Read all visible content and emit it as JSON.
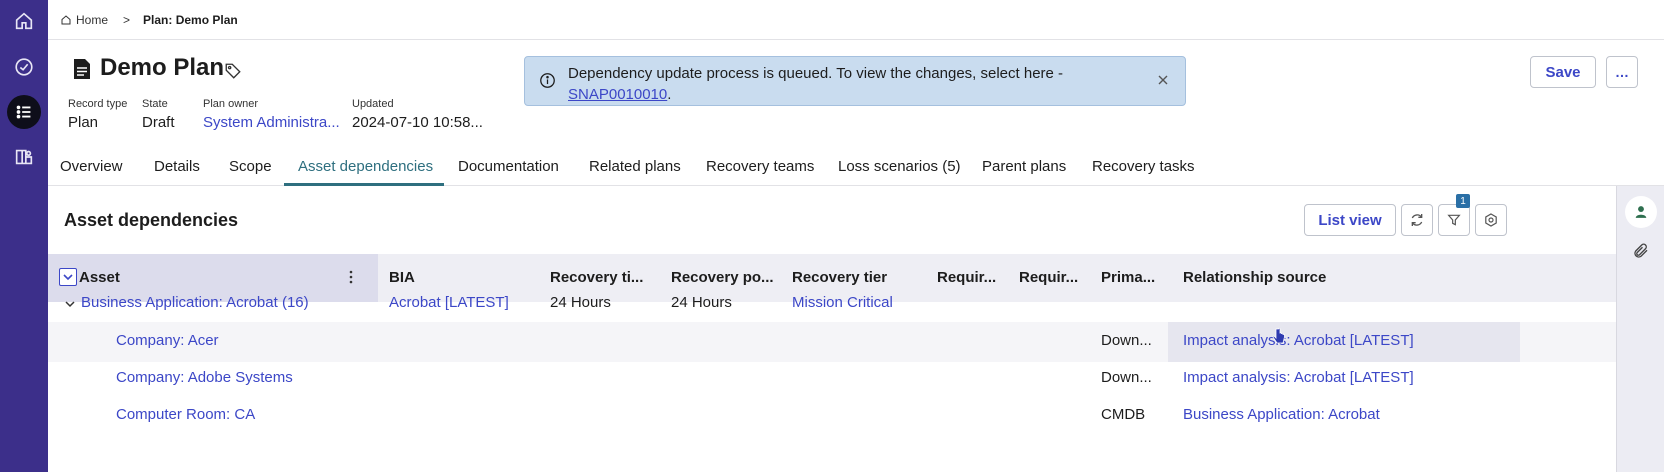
{
  "breadcrumb": {
    "home": "Home",
    "separator": ">",
    "current": "Plan: Demo Plan"
  },
  "record": {
    "title": "Demo Plan",
    "fields": [
      {
        "label": "Record type",
        "value": "Plan"
      },
      {
        "label": "State",
        "value": "Draft"
      },
      {
        "label": "Plan owner",
        "value": "System Administra..."
      },
      {
        "label": "Updated",
        "value": "2024-07-10 10:58..."
      }
    ]
  },
  "notification": {
    "message": "Dependency update process is queued. To view the changes, select here -",
    "link": "SNAP0010010",
    "suffix": "."
  },
  "actions": {
    "save": "Save",
    "more": "…"
  },
  "tabs": [
    "Overview",
    "Details",
    "Scope",
    "Asset dependencies",
    "Documentation",
    "Related plans",
    "Recovery teams",
    "Loss scenarios (5)",
    "Parent plans",
    "Recovery tasks"
  ],
  "active_tab": "Asset dependencies",
  "panel": {
    "title": "Asset dependencies",
    "list_view": "List view",
    "filter_count": "1"
  },
  "table": {
    "columns": [
      "Asset",
      "BIA",
      "Recovery ti...",
      "Recovery po...",
      "Recovery tier",
      "Requir...",
      "Requir...",
      "Prima...",
      "Relationship source"
    ],
    "group": {
      "asset": "Business Application: Acrobat (16)",
      "bia": "Acrobat [LATEST]",
      "rto": "24 Hours",
      "rpo": "24 Hours",
      "tier": "Mission Critical"
    },
    "rows": [
      {
        "asset": "Company: Acer",
        "primary": "Down...",
        "source": "Impact analysis: Acrobat [LATEST]"
      },
      {
        "asset": "Company: Adobe Systems",
        "primary": "Down...",
        "source": "Impact analysis: Acrobat [LATEST]"
      },
      {
        "asset": "Computer Room: CA",
        "primary": "CMDB",
        "source": "Business Application: Acrobat"
      }
    ]
  },
  "icons": {
    "rail": [
      "home-icon",
      "check-circle-icon",
      "list-icon",
      "map-icon"
    ],
    "toolbar": [
      "refresh-icon",
      "filter-icon",
      "settings-icon"
    ],
    "side": [
      "user-icon",
      "paperclip-icon"
    ]
  },
  "colors": {
    "rail": "#3c2f8a",
    "link": "#3c47c7",
    "active_tab": "#2e6f7f",
    "toast": "#c9dcef"
  }
}
